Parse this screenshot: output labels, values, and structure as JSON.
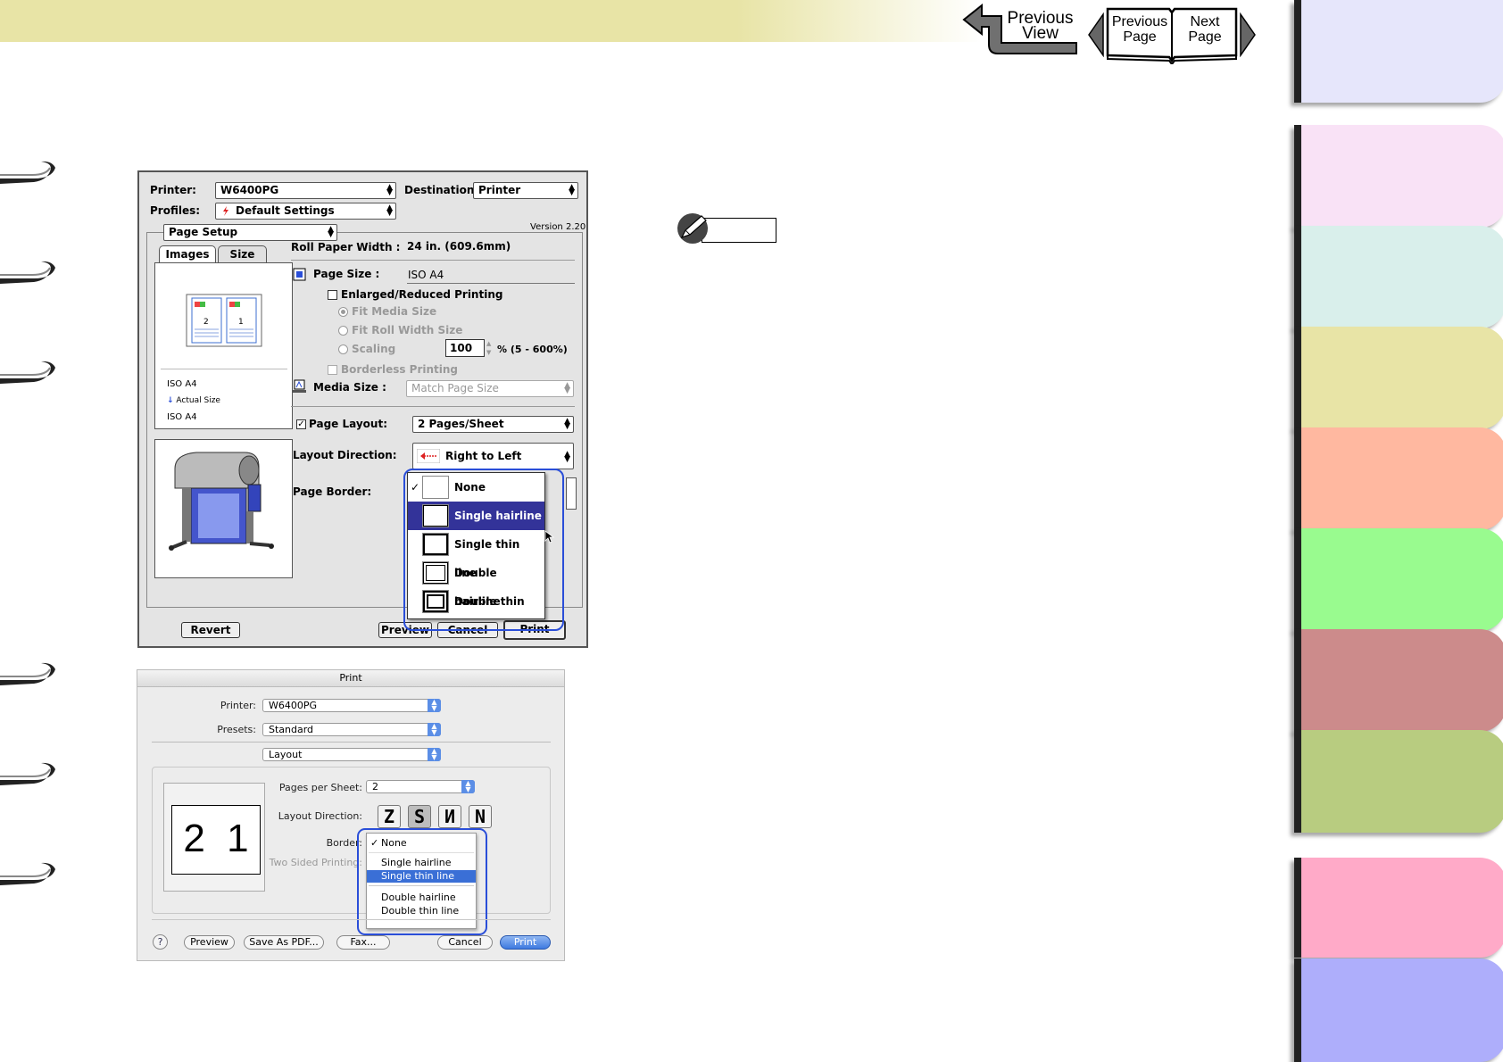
{
  "nav": {
    "previous_view_l1": "Previous",
    "previous_view_l2": "View",
    "previous_page_l1": "Previous",
    "previous_page_l2": "Page",
    "next_page_l1": "Next",
    "next_page_l2": "Page"
  },
  "tab_colors": [
    "#e6e6fb",
    "#f9e2f6",
    "#d9efeb",
    "#e8e4a6",
    "#ffb8a0",
    "#99fb8f",
    "#cc8b8b",
    "#b8cc80",
    "#ffaac8",
    "#aeaefb"
  ],
  "dialog1": {
    "printer_label": "Printer:",
    "printer_value": "W6400PG",
    "destination_label": "Destination:",
    "destination_value": "Printer",
    "profiles_label": "Profiles:",
    "profiles_value": "Default Settings",
    "version": "Version 2.20",
    "panel_value": "Page Setup",
    "tab_images": "Images",
    "tab_size": "Size",
    "preview_page_left": "2",
    "preview_page_right": "1",
    "info_size1": "ISO A4",
    "info_actual": "Actual Size",
    "info_size2": "ISO A4",
    "roll_width_label": "Roll Paper Width :",
    "roll_width_value": "24 in. (609.6mm)",
    "page_size_label": "Page Size :",
    "page_size_value": "ISO A4",
    "enlarged_label": "Enlarged/Reduced Printing",
    "fit_media": "Fit Media Size",
    "fit_roll": "Fit Roll Width Size",
    "scaling": "Scaling",
    "scaling_value": "100",
    "scaling_range": "% (5 - 600%)",
    "borderless": "Borderless Printing",
    "media_size_label": "Media Size :",
    "media_size_value": "Match Page Size",
    "page_layout_label": "Page Layout:",
    "page_layout_value": "2 Pages/Sheet",
    "layout_direction_label": "Layout Direction:",
    "layout_direction_value": "Right to Left",
    "page_border_label": "Page Border:",
    "border_options": [
      "None",
      "Single hairline",
      "Single thin line",
      "Double hairline",
      "Double thin line"
    ],
    "checked_index": 0,
    "highlight_index": 1,
    "revert": "Revert",
    "preview": "Preview",
    "cancel": "Cancel",
    "print": "Print"
  },
  "dialog2": {
    "title": "Print",
    "printer_label": "Printer:",
    "printer_value": "W6400PG",
    "presets_label": "Presets:",
    "presets_value": "Standard",
    "panel_value": "Layout",
    "preview_text": "2 1",
    "pps_label": "Pages per Sheet:",
    "pps_value": "2",
    "layout_direction_label": "Layout Direction:",
    "border_label": "Border:",
    "two_sided_label": "Two Sided Printing:",
    "border_options": [
      "None",
      "Single hairline",
      "Single thin line",
      "Double hairline",
      "Double thin line"
    ],
    "checked_index": 0,
    "highlight_index": 2,
    "help": "?",
    "preview": "Preview",
    "save_pdf": "Save As PDF...",
    "fax": "Fax...",
    "cancel": "Cancel",
    "print": "Print"
  },
  "note_icon": "pencil-note-icon",
  "accent_blue": "#2a4ed8",
  "highlight_navy": "#333399"
}
